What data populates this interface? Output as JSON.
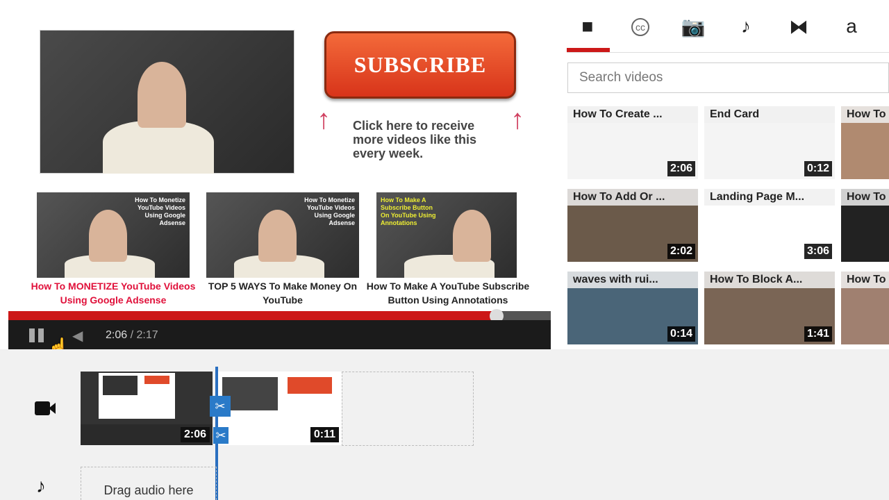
{
  "player": {
    "subscribe_label": "SUBSCRIBE",
    "cta_text": "Click here to receive more videos like this every week.",
    "suggested_videos": [
      {
        "thumb_text": "How To Monetize YouTube Videos Using Google Adsense",
        "caption": "How To MONETIZE  YouTube Videos Using Google Adsense",
        "caption_color": "#e0103a"
      },
      {
        "thumb_text": "How To Monetize YouTube Videos Using Google Adsense",
        "caption": "TOP 5 WAYS To Make Money On YouTube",
        "caption_color": "#222222"
      },
      {
        "thumb_text": "How To Make A Subscribe Button On YouTube Using Annotations",
        "caption": "How  To Make A YouTube Subscribe Button Using Annotations",
        "caption_color": "#222222"
      }
    ],
    "current_time": "2:06",
    "separator": " / ",
    "total_time": "2:17",
    "progress_percent": 90,
    "state": "playing"
  },
  "tabs": [
    {
      "icon": "video-camera-icon",
      "glyph": "■",
      "active": true
    },
    {
      "icon": "closed-captions-icon",
      "glyph": "cc"
    },
    {
      "icon": "camera-icon",
      "glyph": "📷"
    },
    {
      "icon": "music-note-icon",
      "glyph": "♪"
    },
    {
      "icon": "transitions-icon",
      "glyph": "⧓"
    },
    {
      "icon": "text-icon",
      "glyph": "a"
    }
  ],
  "search": {
    "placeholder": "Search videos"
  },
  "videos": [
    {
      "title": "How To Create ...",
      "duration": "2:06",
      "bg": "#f4f4f4"
    },
    {
      "title": "End Card",
      "duration": "0:12",
      "bg": "#f4f4f4"
    },
    {
      "title": "How To",
      "duration": "",
      "bg": "#b08a70"
    },
    {
      "title": "How To Add Or ...",
      "duration": "2:02",
      "bg": "#6b5a4a"
    },
    {
      "title": "Landing Page M...",
      "duration": "3:06",
      "bg": "#ffffff"
    },
    {
      "title": "How To",
      "duration": "",
      "bg": "#222222"
    },
    {
      "title": "waves with rui...",
      "duration": "0:14",
      "bg": "#4a6578"
    },
    {
      "title": "How To Block A...",
      "duration": "1:41",
      "bg": "#7a6555"
    },
    {
      "title": "How To",
      "duration": "",
      "bg": "#a08070"
    }
  ],
  "timeline": {
    "clips": [
      {
        "duration": "2:06"
      },
      {
        "duration": "0:11"
      }
    ],
    "audio_placeholder": "Drag audio here"
  },
  "colors": {
    "accent": "#cc1818",
    "playhead": "#2a6fc0"
  }
}
